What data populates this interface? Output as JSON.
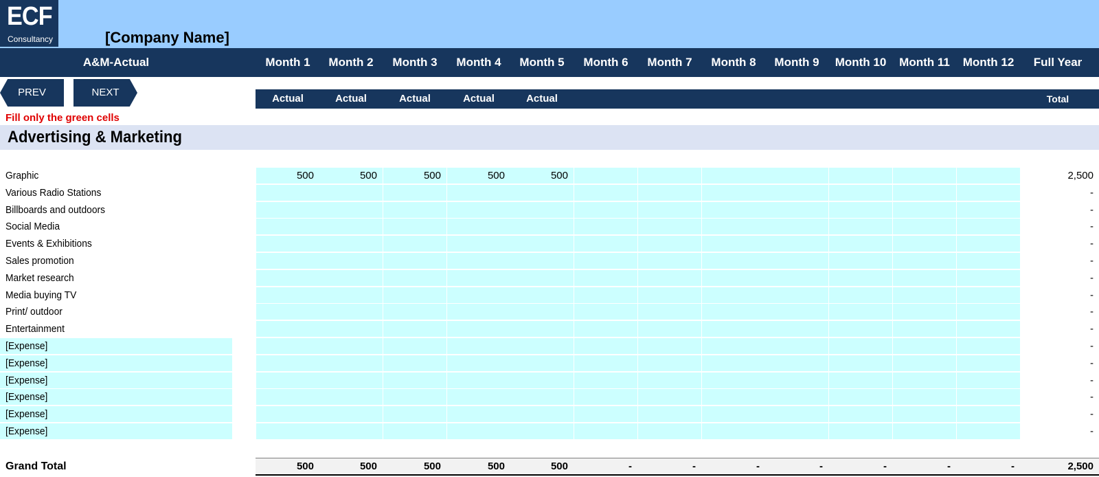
{
  "brand": {
    "logo_big": "ECF",
    "logo_small": "Consultancy"
  },
  "company_name": "[Company Name]",
  "sheet_title": "A&M-Actual",
  "months": [
    "Month 1",
    "Month 2",
    "Month 3",
    "Month 4",
    "Month 5",
    "Month 6",
    "Month 7",
    "Month 8",
    "Month 9",
    "Month 10",
    "Month 11",
    "Month 12"
  ],
  "full_year_label": "Full Year",
  "sub_labels": [
    "Actual",
    "Actual",
    "Actual",
    "Actual",
    "Actual",
    "",
    "",
    "",
    "",
    "",
    "",
    ""
  ],
  "total_label": "Total",
  "nav": {
    "prev": "PREV",
    "next": "NEXT"
  },
  "fill_note": "Fill only the green cells",
  "section_title": "Advertising & Marketing",
  "rows": [
    {
      "label": "Graphic",
      "values": [
        "500",
        "500",
        "500",
        "500",
        "500",
        "",
        "",
        "",
        "",
        "",
        "",
        ""
      ],
      "total": "2,500",
      "editable_label": false
    },
    {
      "label": "Various Radio Stations",
      "values": [
        "",
        "",
        "",
        "",
        "",
        "",
        "",
        "",
        "",
        "",
        "",
        ""
      ],
      "total": "-",
      "editable_label": false
    },
    {
      "label": "Billboards and outdoors",
      "values": [
        "",
        "",
        "",
        "",
        "",
        "",
        "",
        "",
        "",
        "",
        "",
        ""
      ],
      "total": "-",
      "editable_label": false
    },
    {
      "label": "Social Media",
      "values": [
        "",
        "",
        "",
        "",
        "",
        "",
        "",
        "",
        "",
        "",
        "",
        ""
      ],
      "total": "-",
      "editable_label": false
    },
    {
      "label": "Events & Exhibitions",
      "values": [
        "",
        "",
        "",
        "",
        "",
        "",
        "",
        "",
        "",
        "",
        "",
        ""
      ],
      "total": "-",
      "editable_label": false
    },
    {
      "label": "Sales promotion",
      "values": [
        "",
        "",
        "",
        "",
        "",
        "",
        "",
        "",
        "",
        "",
        "",
        ""
      ],
      "total": "-",
      "editable_label": false
    },
    {
      "label": "Market research",
      "values": [
        "",
        "",
        "",
        "",
        "",
        "",
        "",
        "",
        "",
        "",
        "",
        ""
      ],
      "total": "-",
      "editable_label": false
    },
    {
      "label": "Media buying TV",
      "values": [
        "",
        "",
        "",
        "",
        "",
        "",
        "",
        "",
        "",
        "",
        "",
        ""
      ],
      "total": "-",
      "editable_label": false
    },
    {
      "label": "Print/ outdoor",
      "values": [
        "",
        "",
        "",
        "",
        "",
        "",
        "",
        "",
        "",
        "",
        "",
        ""
      ],
      "total": "-",
      "editable_label": false
    },
    {
      "label": "Entertainment",
      "values": [
        "",
        "",
        "",
        "",
        "",
        "",
        "",
        "",
        "",
        "",
        "",
        ""
      ],
      "total": "-",
      "editable_label": false
    },
    {
      "label": "[Expense]",
      "values": [
        "",
        "",
        "",
        "",
        "",
        "",
        "",
        "",
        "",
        "",
        "",
        ""
      ],
      "total": "-",
      "editable_label": true
    },
    {
      "label": "[Expense]",
      "values": [
        "",
        "",
        "",
        "",
        "",
        "",
        "",
        "",
        "",
        "",
        "",
        ""
      ],
      "total": "-",
      "editable_label": true
    },
    {
      "label": "[Expense]",
      "values": [
        "",
        "",
        "",
        "",
        "",
        "",
        "",
        "",
        "",
        "",
        "",
        ""
      ],
      "total": "-",
      "editable_label": true
    },
    {
      "label": "[Expense]",
      "values": [
        "",
        "",
        "",
        "",
        "",
        "",
        "",
        "",
        "",
        "",
        "",
        ""
      ],
      "total": "-",
      "editable_label": true
    },
    {
      "label": "[Expense]",
      "values": [
        "",
        "",
        "",
        "",
        "",
        "",
        "",
        "",
        "",
        "",
        "",
        ""
      ],
      "total": "-",
      "editable_label": true
    },
    {
      "label": "[Expense]",
      "values": [
        "",
        "",
        "",
        "",
        "",
        "",
        "",
        "",
        "",
        "",
        "",
        ""
      ],
      "total": "-",
      "editable_label": true
    }
  ],
  "grand_total": {
    "label": "Grand Total",
    "values": [
      "500",
      "500",
      "500",
      "500",
      "500",
      "-",
      "-",
      "-",
      "-",
      "-",
      "-",
      "-"
    ],
    "total": "2,500"
  },
  "colors": {
    "navy": "#17365d",
    "header_blue": "#99ccff",
    "input_cyan": "#ccffff",
    "section_band": "#dce3f3",
    "note_red": "#e00000"
  }
}
